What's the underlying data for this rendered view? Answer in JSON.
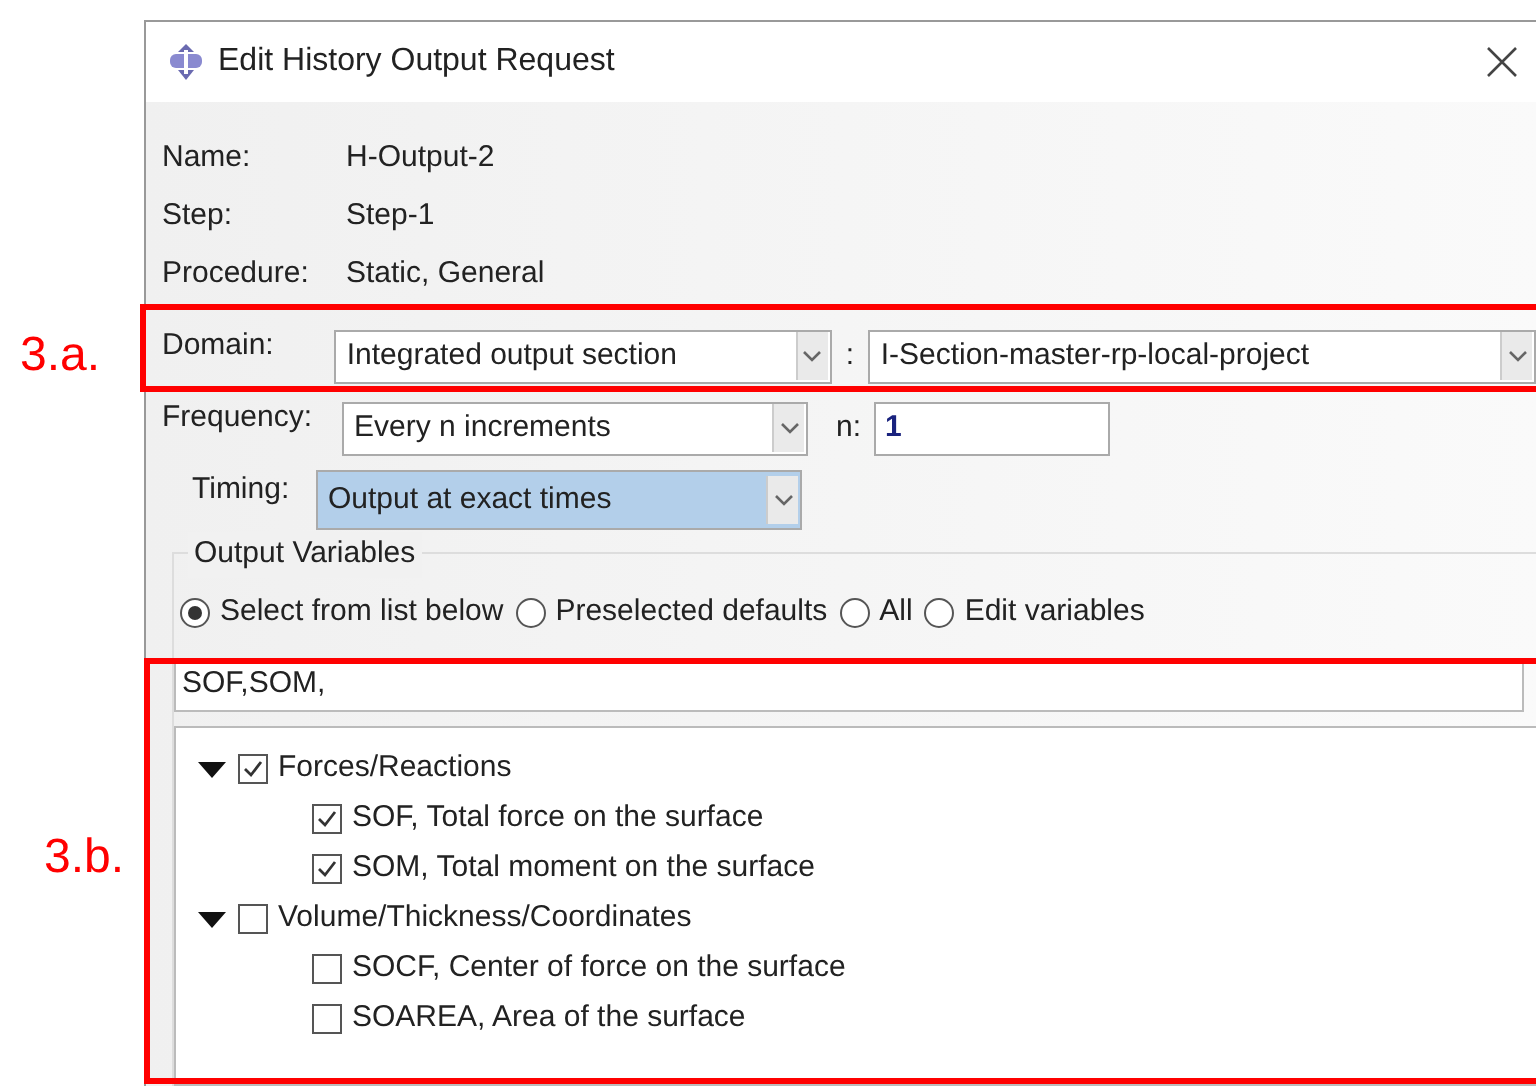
{
  "window": {
    "title": "Edit History Output Request"
  },
  "fields": [
    {
      "label": "Name:",
      "value": "H-Output-2"
    },
    {
      "label": "Step:",
      "value": "Step-1"
    },
    {
      "label": "Procedure:",
      "value": "Static, General"
    }
  ],
  "domain": {
    "label": "Domain:",
    "value": "Integrated output section",
    "separator": ":",
    "section": "I-Section-master-rp-local-project"
  },
  "frequency": {
    "label": "Frequency:",
    "value": "Every n increments",
    "n_label": "n:",
    "n_value": "1"
  },
  "timing": {
    "label": "Timing:",
    "value": "Output at exact times"
  },
  "output_variables": {
    "title": "Output Variables",
    "options": [
      {
        "label": "Select from list below",
        "selected": true
      },
      {
        "label": "Preselected defaults",
        "selected": false
      },
      {
        "label": "All",
        "selected": false
      },
      {
        "label": "Edit variables",
        "selected": false
      }
    ],
    "text": "SOF,SOM,",
    "tree": [
      {
        "label": "Forces/Reactions",
        "checked": true,
        "expanded": true,
        "children": [
          {
            "label": "SOF, Total force on the surface",
            "checked": true
          },
          {
            "label": "SOM, Total moment on the surface",
            "checked": true
          }
        ]
      },
      {
        "label": "Volume/Thickness/Coordinates",
        "checked": false,
        "expanded": true,
        "children": [
          {
            "label": "SOCF, Center of force on the surface",
            "checked": false
          },
          {
            "label": "SOAREA, Area of the surface",
            "checked": false
          }
        ]
      }
    ]
  },
  "annotations": [
    {
      "label": "3.a."
    },
    {
      "label": "3.b."
    }
  ]
}
